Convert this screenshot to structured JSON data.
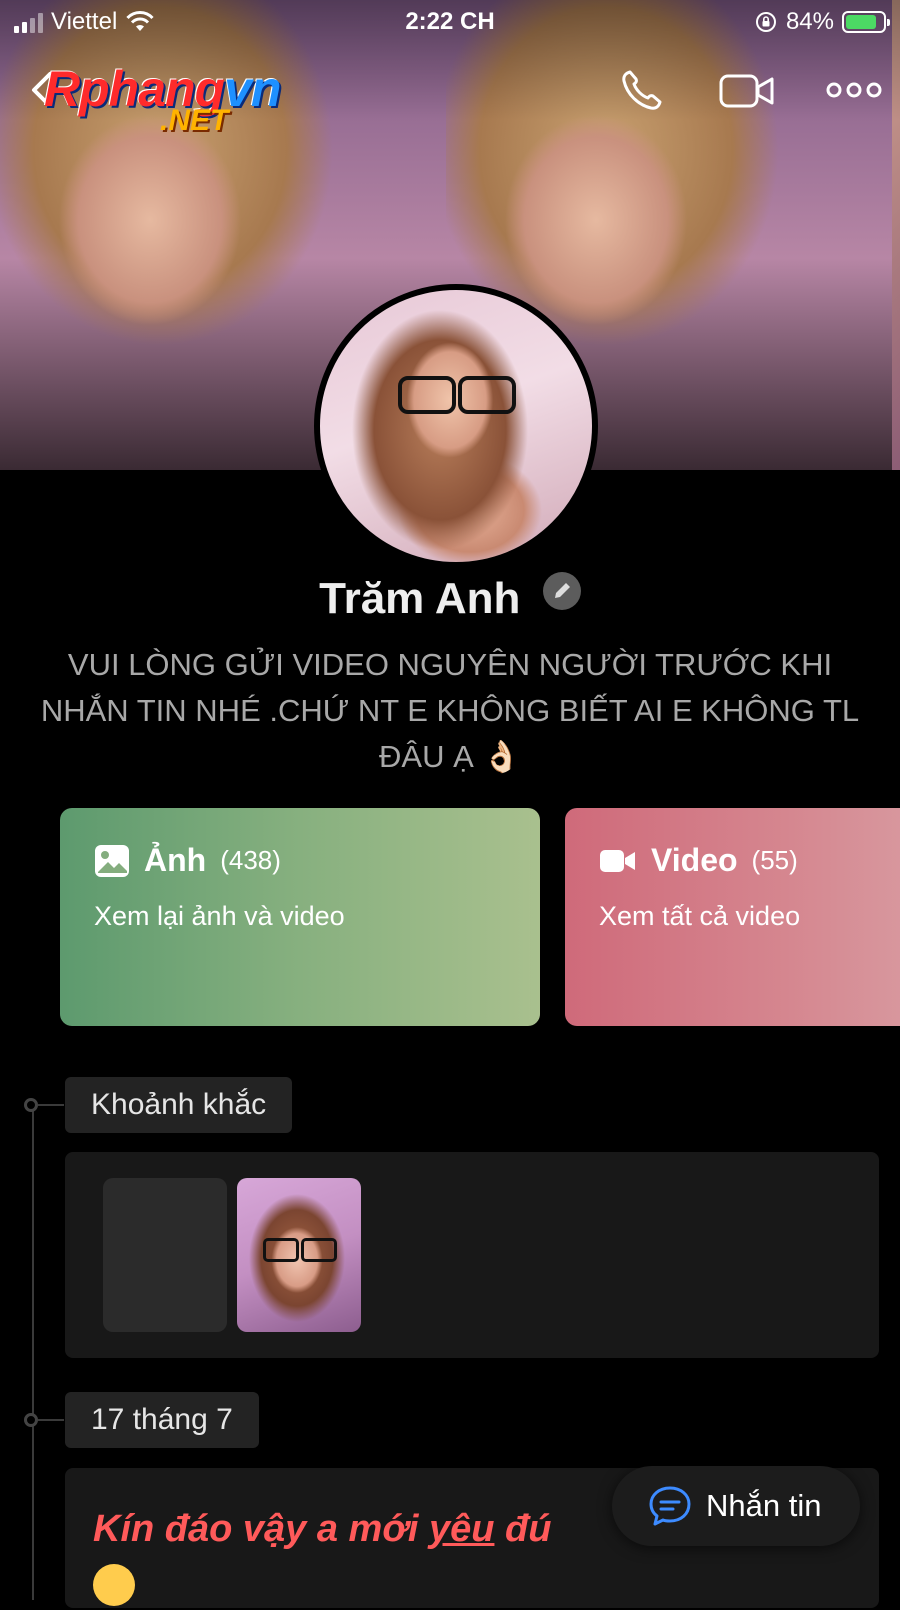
{
  "status_bar": {
    "carrier": "Viettel",
    "time": "2:22 CH",
    "battery_percent": "84%",
    "battery_level": 0.84
  },
  "watermark": {
    "part1": "Rphang",
    "part2": "vn",
    "part3": ".NET"
  },
  "profile": {
    "name": "Trăm Anh",
    "bio": "VUI LÒNG GỬI VIDEO NGUYÊN NGƯỜI TRƯỚC KHI NHẮN TIN NHÉ .CHỨ NT E KHÔNG BIẾT AI E KHÔNG TL ĐÂU Ạ 👌🏻"
  },
  "cards": {
    "photos": {
      "title": "Ảnh",
      "count": "(438)",
      "subtitle": "Xem lại ảnh và video",
      "icon": "image-icon"
    },
    "videos": {
      "title": "Video",
      "count": "(55)",
      "subtitle": "Xem tất cả video",
      "icon": "video-camera-icon"
    }
  },
  "timeline": {
    "moments_label": "Khoảnh khắc",
    "date_label": "17 tháng 7",
    "post_text_before": "Kín đáo vậy a mới ",
    "post_text_underlined": "yêu",
    "post_text_after": " đú",
    "post_emoji": "😌"
  },
  "message_button": {
    "label": "Nhắn tin",
    "icon": "chat-bubble-icon"
  },
  "icons": [
    "back-arrow-icon",
    "phone-icon",
    "video-call-icon",
    "more-icon",
    "edit-icon",
    "wifi-icon",
    "orientation-lock-icon",
    "battery-icon"
  ],
  "colors": {
    "background": "#000000",
    "photos_card_start": "#5d9a6e",
    "photos_card_end": "#a9c08e",
    "videos_card_start": "#cf6a7a",
    "videos_card_end": "#d9a0a5",
    "post_text": "#ff5a5a",
    "accent_blue": "#3d8bff"
  }
}
